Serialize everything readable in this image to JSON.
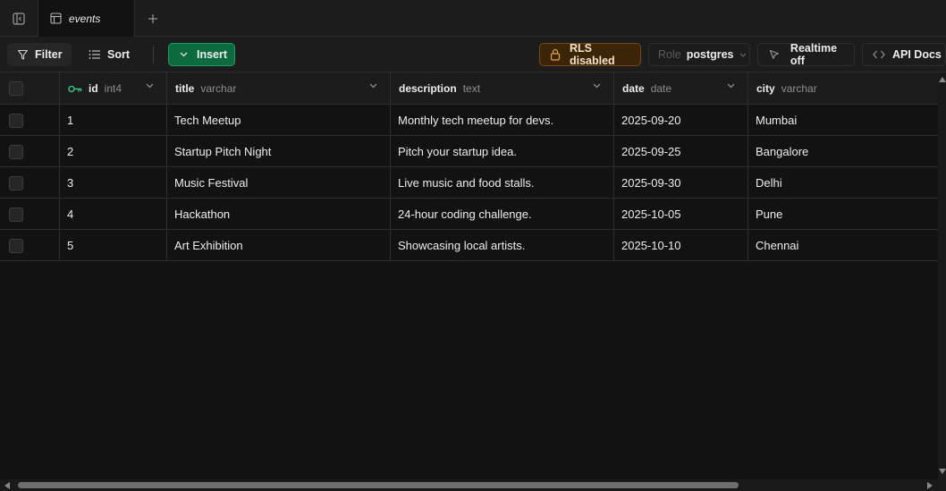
{
  "tabs": [
    {
      "label": "events",
      "icon": "table-icon",
      "active": true
    }
  ],
  "toolbar": {
    "filter_label": "Filter",
    "sort_label": "Sort",
    "insert_label": "Insert",
    "rls_label": "RLS disabled",
    "role_prefix": "Role",
    "role_value": "postgres",
    "realtime_label": "Realtime off",
    "api_docs_label": "API Docs"
  },
  "columns": [
    {
      "name": "id",
      "type": "int4",
      "primary_key": true
    },
    {
      "name": "title",
      "type": "varchar"
    },
    {
      "name": "description",
      "type": "text"
    },
    {
      "name": "date",
      "type": "date"
    },
    {
      "name": "city",
      "type": "varchar"
    }
  ],
  "rows": [
    {
      "id": "1",
      "title": "Tech Meetup",
      "description": "Monthly tech meetup for devs.",
      "date": "2025-09-20",
      "city": "Mumbai"
    },
    {
      "id": "2",
      "title": "Startup Pitch Night",
      "description": "Pitch your startup idea.",
      "date": "2025-09-25",
      "city": "Bangalore"
    },
    {
      "id": "3",
      "title": "Music Festival",
      "description": "Live music and food stalls.",
      "date": "2025-09-30",
      "city": "Delhi"
    },
    {
      "id": "4",
      "title": "Hackathon",
      "description": "24-hour coding challenge.",
      "date": "2025-10-05",
      "city": "Pune"
    },
    {
      "id": "5",
      "title": "Art Exhibition",
      "description": "Showcasing local artists.",
      "date": "2025-10-10",
      "city": "Chennai"
    }
  ],
  "colors": {
    "background": "#121212",
    "panel": "#1c1c1c",
    "insert_green": "#0b6b3f",
    "rls_amber": "#3b2508",
    "primary_key_green": "#3ecf8e"
  }
}
